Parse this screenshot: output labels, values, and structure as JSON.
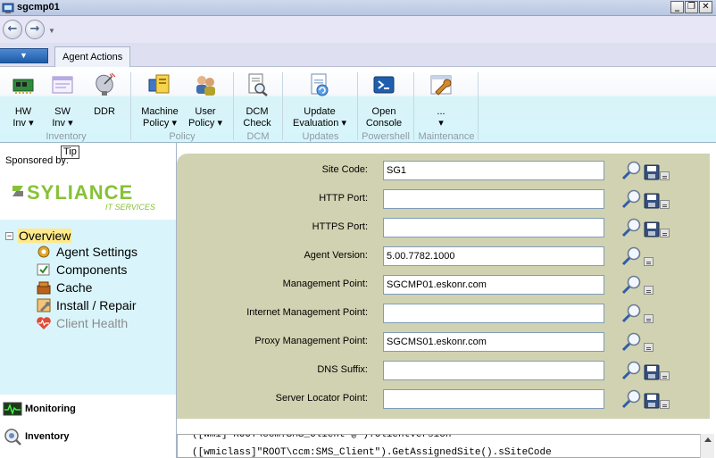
{
  "window": {
    "title": "sgcmp01",
    "min_glyph": "_",
    "max_glyph": "❐",
    "close_glyph": "✕"
  },
  "nav": {
    "back_glyph": "←",
    "forward_glyph": "→",
    "dropdown_glyph": "▼"
  },
  "ribbon_tabs": {
    "file_menu_glyph": "▼",
    "active_tab": "Agent Actions"
  },
  "ribbon": {
    "buttons": [
      {
        "id": "hw-inv",
        "line1": "HW",
        "line2": "Inv",
        "dropdown": "▾",
        "icon": "hardware-icon"
      },
      {
        "id": "sw-inv",
        "line1": "SW",
        "line2": "Inv",
        "dropdown": "▾",
        "icon": "software-icon"
      },
      {
        "id": "ddr",
        "line1": "DDR",
        "line2": "",
        "dropdown": "",
        "icon": "satellite-icon"
      },
      {
        "id": "machine-policy",
        "line1": "Machine",
        "line2": "Policy",
        "dropdown": "▾",
        "icon": "machine-policy-icon"
      },
      {
        "id": "user-policy",
        "line1": "User",
        "line2": "Policy",
        "dropdown": "▾",
        "icon": "users-icon"
      },
      {
        "id": "dcm-check",
        "line1": "DCM",
        "line2": "Check",
        "dropdown": "",
        "icon": "document-search-icon"
      },
      {
        "id": "update-evaluation",
        "line1": "Update",
        "line2": "Evaluation",
        "dropdown": "▾",
        "icon": "update-icon"
      },
      {
        "id": "open-console",
        "line1": "Open",
        "line2": "Console",
        "dropdown": "",
        "icon": "powershell-icon"
      },
      {
        "id": "more",
        "line1": "...",
        "line2": "",
        "dropdown": "▾",
        "icon": "wrench-icon"
      }
    ],
    "groups": [
      "Inventory",
      "Policy",
      "DCM",
      "Updates",
      "Powershell",
      "Maintenance"
    ]
  },
  "left": {
    "sponsored_label": "Sponsored by:",
    "tooltip": "Tip",
    "logo_text": "SYLIANCE",
    "logo_subtext": "IT SERVICES",
    "tree": {
      "root": "Overview",
      "expander": "−",
      "items": [
        {
          "label": "Agent Settings",
          "icon": "agent-settings-icon"
        },
        {
          "label": "Components",
          "icon": "components-icon"
        },
        {
          "label": "Cache",
          "icon": "cache-icon"
        },
        {
          "label": "Install / Repair",
          "icon": "install-repair-icon"
        },
        {
          "label": "Client Health",
          "icon": "client-health-icon"
        }
      ]
    },
    "sections": [
      {
        "label": "Monitoring",
        "icon": "monitoring-icon"
      },
      {
        "label": "Inventory",
        "icon": "inventory-icon"
      }
    ]
  },
  "form": {
    "fields": [
      {
        "label": "Site Code:",
        "value": "SG1",
        "save": true
      },
      {
        "label": "HTTP Port:",
        "value": "",
        "save": true
      },
      {
        "label": "HTTPS Port:",
        "value": "",
        "save": true
      },
      {
        "label": "Agent Version:",
        "value": "5.00.7782.1000",
        "save": false
      },
      {
        "label": "Management Point:",
        "value": "SGCMP01.eskonr.com",
        "save": false
      },
      {
        "label": "Internet Management Point:",
        "value": "",
        "save": false
      },
      {
        "label": "Proxy Management Point:",
        "value": "SGCMS01.eskonr.com",
        "save": false
      },
      {
        "label": "DNS Suffix:",
        "value": "",
        "save": true
      },
      {
        "label": "Server Locator Point:",
        "value": "",
        "save": true
      }
    ]
  },
  "console": {
    "line1": "([wmi]\"ROOT\\ccm:SMS_Client=@\").ClientVersion",
    "line2": "([wmiclass]\"ROOT\\ccm:SMS_Client\").GetAssignedSite().sSiteCode"
  },
  "colors": {
    "form_bg": "#d1d2b1",
    "tree_bg": "#d9f5fb",
    "ribbon_lower": "#d6f5fa",
    "overview_highlight": "#ffe98a",
    "logo_green": "#86c236",
    "logo_gray": "#7b7b7b"
  }
}
